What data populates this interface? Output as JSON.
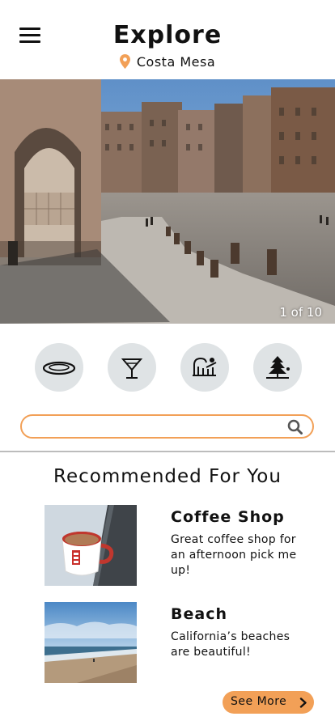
{
  "header": {
    "title": "Explore",
    "location": "Costa Mesa"
  },
  "hero": {
    "counter": "1 of 10"
  },
  "categories": [
    {
      "icon": "plate-icon"
    },
    {
      "icon": "cocktail-icon"
    },
    {
      "icon": "sun-landscape-icon"
    },
    {
      "icon": "beach-umbrella-icon"
    }
  ],
  "search": {
    "value": "",
    "placeholder": ""
  },
  "recommended": {
    "title": "Recommended For You",
    "items": [
      {
        "title": "Coffee Shop",
        "description": "Great coffee shop for an afternoon pick me up!"
      },
      {
        "title": "Beach",
        "description": "California’s beaches are beautiful!"
      }
    ],
    "see_more": "See More"
  },
  "colors": {
    "accent": "#f2a057",
    "category_bg": "#dfe3e5"
  }
}
